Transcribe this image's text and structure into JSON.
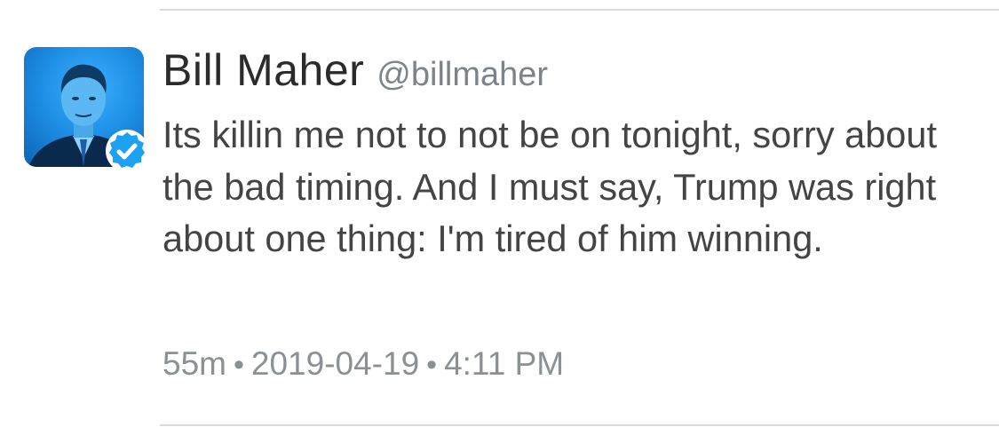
{
  "tweet": {
    "display_name": "Bill Maher",
    "handle": "@billmaher",
    "text": "Its killin me not to not be on tonight, sorry about the bad timing. And I must say, Trump was right about one thing: I'm tired of him winning.",
    "relative_time": "55m",
    "date": "2019-04-19",
    "time": "4:11 PM",
    "separator": "•",
    "verified": true,
    "avatar_icon": "profile-photo",
    "badge_icon": "verified-check-icon",
    "accent_color": "#1da1f2"
  }
}
